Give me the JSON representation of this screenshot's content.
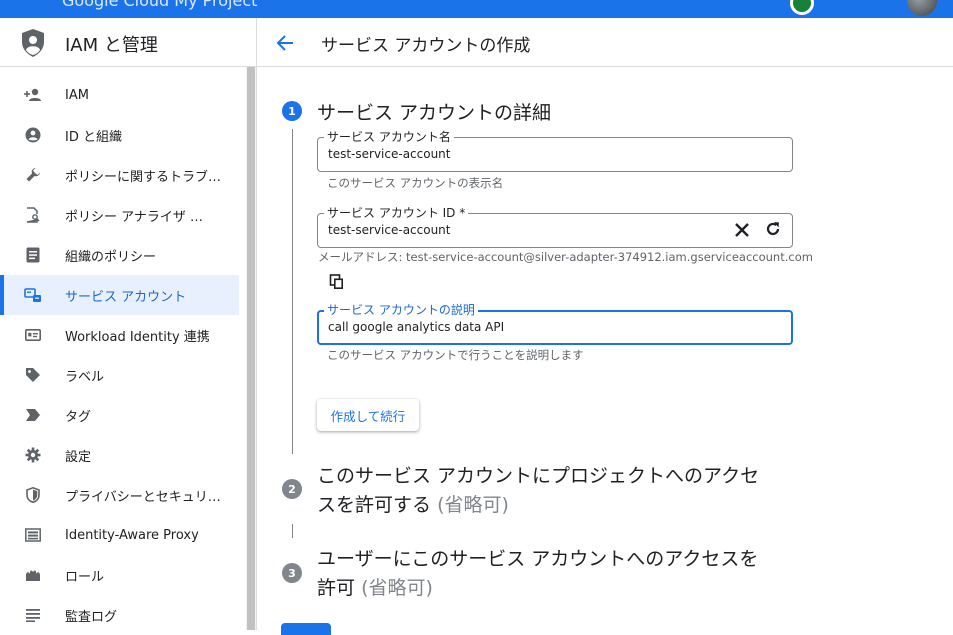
{
  "topbar": {
    "brand": "Google Cloud  My Project"
  },
  "sidebar": {
    "title": "IAM と管理",
    "items": [
      {
        "label": "IAM",
        "icon": "person-add-icon"
      },
      {
        "label": "ID と組織",
        "icon": "account-circle-icon"
      },
      {
        "label": "ポリシーに関するトラブ…",
        "icon": "wrench-icon"
      },
      {
        "label": "ポリシー アナライザ …",
        "icon": "document-search-icon"
      },
      {
        "label": "組織のポリシー",
        "icon": "list-document-icon"
      },
      {
        "label": "サービス アカウント",
        "icon": "service-account-icon"
      },
      {
        "label": "Workload Identity 連携",
        "icon": "id-card-icon"
      },
      {
        "label": "ラベル",
        "icon": "label-icon"
      },
      {
        "label": "タグ",
        "icon": "tag-icon"
      },
      {
        "label": "設定",
        "icon": "gear-icon"
      },
      {
        "label": "プライバシーとセキュリ…",
        "icon": "shield-icon"
      },
      {
        "label": "Identity-Aware Proxy",
        "icon": "proxy-icon"
      },
      {
        "label": "ロール",
        "icon": "roles-icon"
      },
      {
        "label": "監査ログ",
        "icon": "audit-log-icon"
      }
    ],
    "active_index": 5
  },
  "header": {
    "title": "サービス アカウントの作成"
  },
  "steps": [
    {
      "number": "1",
      "title": "サービス アカウントの詳細"
    },
    {
      "number": "2",
      "title_line1": "このサービス アカウントにプロジェクトへのアクセ",
      "title_line2": "スを許可する",
      "optional": "(省略可)"
    },
    {
      "number": "3",
      "title_line1": "ユーザーにこのサービス アカウントへのアクセスを",
      "title_line2": "許可",
      "optional": "(省略可)"
    }
  ],
  "form": {
    "name_label": "サービス アカウント名",
    "name_value": "test-service-account",
    "name_hint": "このサービス アカウントの表示名",
    "id_label": "サービス アカウント ID *",
    "id_value": "test-service-account",
    "email_line": "メールアドレス: test-service-account@silver-adapter-374912.iam.gserviceaccount.com",
    "desc_label": "サービス アカウントの説明",
    "desc_value": "call google analytics data API",
    "desc_hint": "このサービス アカウントで行うことを説明します",
    "create_button": "作成して続行"
  }
}
